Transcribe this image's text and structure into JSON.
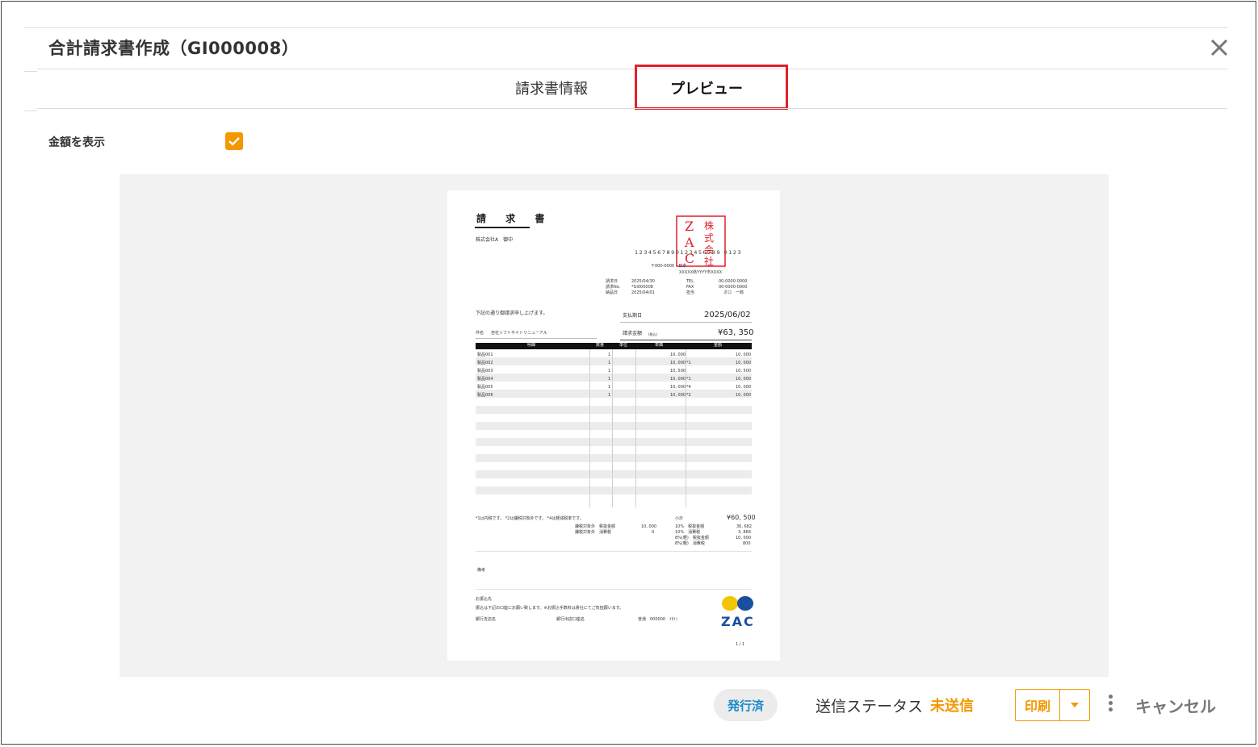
{
  "header": {
    "title": "合計請求書作成（GI000008）",
    "close_icon": "close-icon"
  },
  "tabs": [
    {
      "label": "請求書情報",
      "active": false
    },
    {
      "label": "プレビュー",
      "active": true
    }
  ],
  "options": {
    "show_amount_label": "金額を表示",
    "show_amount_checked": true
  },
  "invoice": {
    "title": "請 求 書",
    "recipient": "株式会社A　御中",
    "registration_no": "1234567890123456789 0123",
    "postal": "〒000-0000　日本",
    "address": "XXXXX県YYYY市XXXX",
    "meta_left": [
      {
        "label": "請求日",
        "value": "2025/04/30"
      },
      {
        "label": "請求No.",
        "value": "*GI000008"
      },
      {
        "label": "納品日",
        "value": "2025/04/01"
      }
    ],
    "meta_right": [
      {
        "label": "TEL",
        "value": "00-0000-0000"
      },
      {
        "label": "FAX",
        "value": "00-0000-0000"
      },
      {
        "label": "担当",
        "value": "オロ　一郎"
      }
    ],
    "greeting": "下記の通り御請求申し上げます。",
    "due_label": "支払期日",
    "due_value": "2025/06/02",
    "subject_label": "件名",
    "subject_value": "自社ソフトサイトリニューアル",
    "amount_label": "請求金額",
    "amount_tax_note": "(税込)",
    "amount_value": "¥63, 350",
    "table_headers": [
      "明細",
      "数量",
      "単位",
      "単価",
      "金額"
    ],
    "rows": [
      {
        "item": "製品001",
        "qty": "1",
        "price": "10, 000",
        "mark": "",
        "amount": "10, 000"
      },
      {
        "item": "製品002",
        "qty": "1",
        "price": "10, 000",
        "mark": "*1",
        "amount": "10, 000"
      },
      {
        "item": "製品003",
        "qty": "1",
        "price": "10, 500",
        "mark": "",
        "amount": "10, 500"
      },
      {
        "item": "製品004",
        "qty": "1",
        "price": "10, 000",
        "mark": "*1",
        "amount": "10, 000"
      },
      {
        "item": "製品005",
        "qty": "1",
        "price": "10, 000",
        "mark": "*4",
        "amount": "10, 000"
      },
      {
        "item": "製品006",
        "qty": "1",
        "price": "10, 000",
        "mark": "*2",
        "amount": "10, 000"
      }
    ],
    "footnote": "*1は内税です。 *2は課税対象外です。 *4は軽減税率です。",
    "subtotal_label": "小計",
    "subtotal_value": "¥60, 500",
    "summary_mid": [
      {
        "label": "課税対象外　税抜金額",
        "value": "10, 000"
      },
      {
        "label": "課税対象外　消費税",
        "value": "0"
      }
    ],
    "summary_right": [
      {
        "label": "10%　税抜金額",
        "value": "36, 682"
      },
      {
        "label": "10%　消費税",
        "value": "3, 868"
      },
      {
        "label": "8%(軽)　税抜金額",
        "value": "10, 000"
      },
      {
        "label": "8%(軽)　消費税",
        "value": "800"
      }
    ],
    "remarks_label": "備考",
    "bank_title": "お振込先",
    "bank_note": "振込は下記の口座にお願い致します。※お振込手数料は貴社にてご負担願います。",
    "bank_fields": [
      "銀行支店名",
      "銀行出店口座名",
      "普通　000000　ｲﾀｲﾝ"
    ],
    "page": "1 / 1",
    "seal_text": [
      "Z",
      "A",
      "C",
      "株",
      "式",
      "会",
      "社"
    ],
    "logo_text": "ZAC"
  },
  "footer": {
    "status_badge": "発行済",
    "send_status_label": "送信ステータス",
    "send_status_value": "未送信",
    "print_label": "印刷",
    "cancel_label": "キャンセル"
  },
  "colors": {
    "accent": "#f39800",
    "highlight": "#e0202a",
    "badge_text": "#1b8bc9",
    "seal": "#e0202a"
  }
}
